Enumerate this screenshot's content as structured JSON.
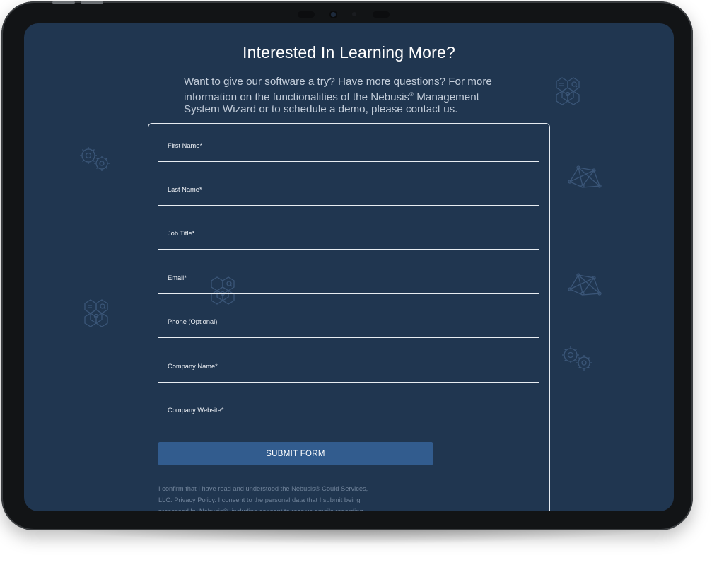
{
  "page": {
    "heading": "Interested In Learning More?",
    "intro_part1": "Want to give our software a try? Have more questions? For more information on the functionalities of the Nebusis",
    "intro_reg": "®",
    "intro_part2": " Management System Wizard or to schedule a demo, please contact us."
  },
  "form": {
    "fields": [
      {
        "label": "First Name*"
      },
      {
        "label": "Last Name*"
      },
      {
        "label": "Job Title*"
      },
      {
        "label": "Email*"
      },
      {
        "label": "Phone (Optional)"
      },
      {
        "label": "Company Name*"
      },
      {
        "label": "Company Website*"
      }
    ],
    "submit_label": "SUBMIT FORM",
    "consent_text": "I confirm that I have read and understood the Nebusis® Could Services, LLC. Privacy Policy. I consent to the personal data that I submit being processed by Nebusis®, including consent to receive emails regarding"
  },
  "decorations": [
    "gears-icon",
    "hexagon-cluster-icon",
    "network-diagram-icon"
  ],
  "colors": {
    "screen_background": "#203650",
    "submit_button": "#325c8e",
    "field_line": "#e8edf2",
    "bezel": "#121416"
  }
}
